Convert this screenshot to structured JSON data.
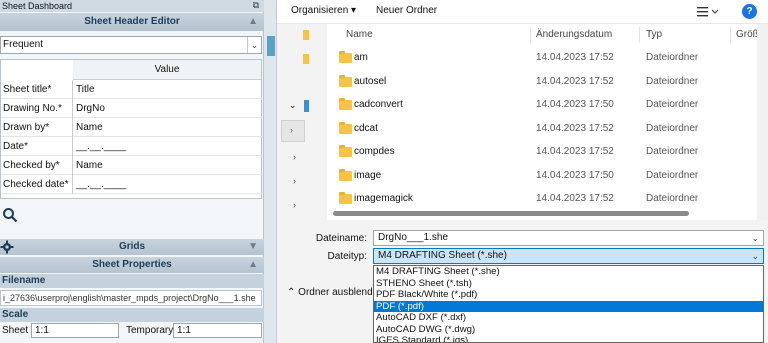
{
  "dashboard": {
    "title": "Sheet Dashboard",
    "pin_icon": "restore-icon",
    "header_editor_title": "Sheet Header Editor",
    "preset_value": "Frequent",
    "table_header": "Value",
    "rows": [
      {
        "key": "Sheet title*",
        "value": "Title"
      },
      {
        "key": "Drawing No.*",
        "value": "DrgNo"
      },
      {
        "key": "Drawn by*",
        "value": "Name"
      },
      {
        "key": "Date*",
        "value": "__.__.____"
      },
      {
        "key": "Checked by*",
        "value": "Name"
      },
      {
        "key": "Checked date*",
        "value": "__.__.____"
      }
    ],
    "grids_title": "Grids",
    "properties_title": "Sheet Properties",
    "filename_label": "Filename",
    "filename_value": "i_27636\\userproj\\english\\master_mpds_project\\DrgNo___1.she",
    "scale_label": "Scale",
    "sheet_label": "Sheet",
    "sheet_value": "1:1",
    "temporary_label": "Temporary",
    "temporary_value": "1:1"
  },
  "dialog": {
    "toolbar": {
      "organize": "Organisieren ▾",
      "new_folder": "Neuer Ordner",
      "view_icon": "view-options-icon",
      "help": "?"
    },
    "columns": {
      "name": "Name",
      "date": "Änderungsdatum",
      "type": "Typ",
      "size": "Größ"
    },
    "files": [
      {
        "name": "am",
        "date": "14.04.2023 17:52",
        "type": "Dateiordner"
      },
      {
        "name": "autosel",
        "date": "14.04.2023 17:52",
        "type": "Dateiordner"
      },
      {
        "name": "cadconvert",
        "date": "14.04.2023 17:50",
        "type": "Dateiordner"
      },
      {
        "name": "cdcat",
        "date": "14.04.2023 17:52",
        "type": "Dateiordner"
      },
      {
        "name": "compdes",
        "date": "14.04.2023 17:52",
        "type": "Dateiordner"
      },
      {
        "name": "image",
        "date": "14.04.2023 17:50",
        "type": "Dateiordner"
      },
      {
        "name": "imagemagick",
        "date": "14.04.2023 17:52",
        "type": "Dateiordner"
      }
    ],
    "filename_label": "Dateiname:",
    "filename_value": "DrgNo___1.she",
    "filetype_label": "Dateityp:",
    "filetype_value": "M4 DRAFTING Sheet (*.she)",
    "collapse_label": "Ordner ausblende",
    "filetype_options": [
      "M4 DRAFTING Sheet (*.she)",
      "STHENO Sheet (*.tsh)",
      "PDF Black/White (*.pdf)",
      "PDF (*.pdf)",
      "AutoCAD DXF (*.dxf)",
      "AutoCAD DWG (*.dwg)",
      "IGES Standard (*.igs)"
    ],
    "highlighted_option_index": 3
  }
}
